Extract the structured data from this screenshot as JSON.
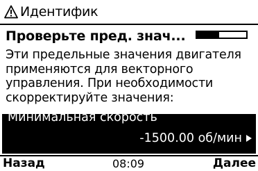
{
  "topbar": {
    "icon": "warning-triangle-icon",
    "title": "Идентифик"
  },
  "heading": {
    "title": "Проверьте пред. знач...",
    "progress_fraction": 0.45
  },
  "body": {
    "text": "Эти предельные значения двигателя применяются для векторного управления. При необходимости скорректируйте значения:"
  },
  "parameter": {
    "name": "Минимальная скорость",
    "value": "-1500.00 об/мин",
    "selected": true
  },
  "softkeys": {
    "left": "Назад",
    "clock": "08:09",
    "right": "Далее"
  },
  "colors": {
    "foreground": "#000000",
    "background": "#ffffff"
  }
}
